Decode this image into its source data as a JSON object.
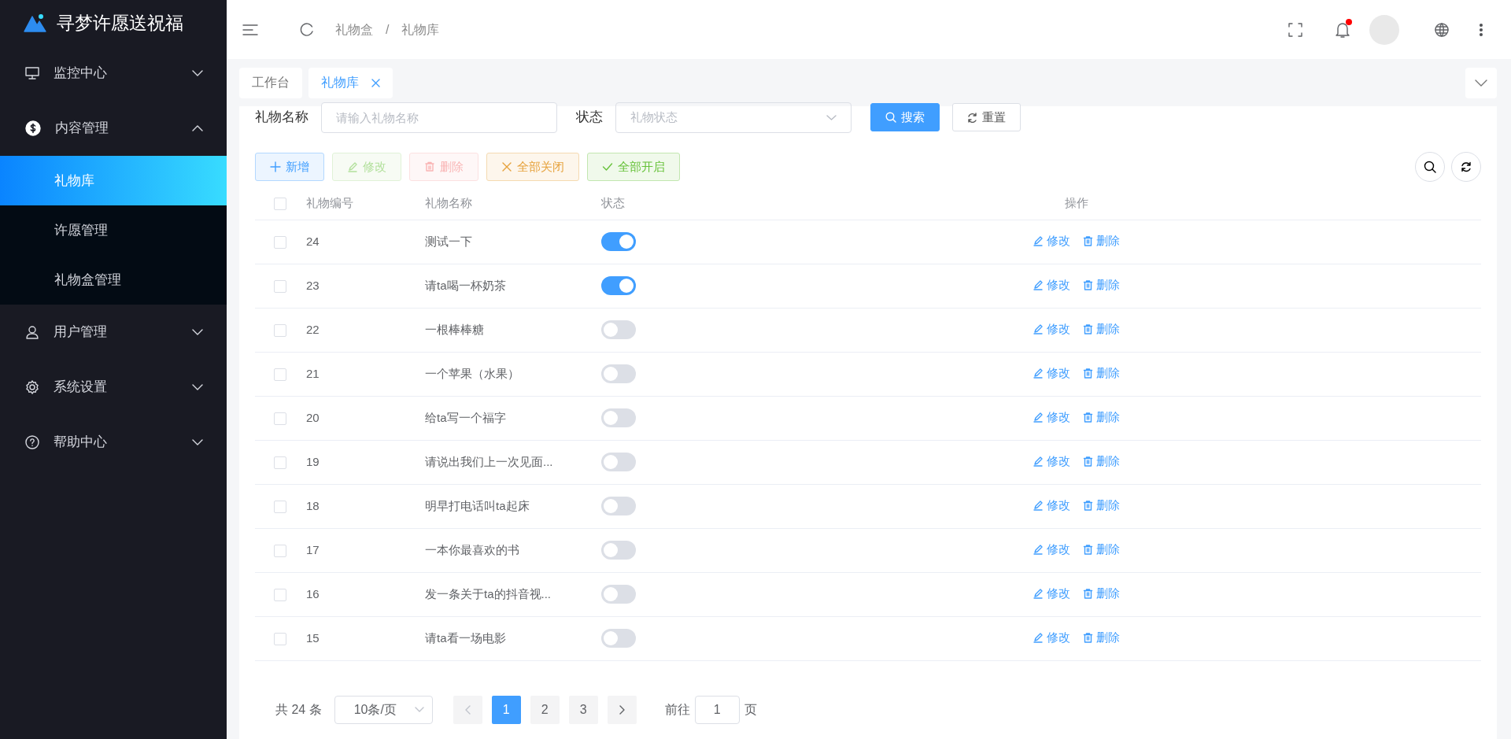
{
  "app": {
    "title": "寻梦许愿送祝福"
  },
  "sidebar": {
    "items": [
      {
        "label": "监控中心",
        "expanded": false
      },
      {
        "label": "内容管理",
        "expanded": true,
        "children": [
          {
            "label": "礼物库",
            "selected": true
          },
          {
            "label": "许愿管理",
            "selected": false
          },
          {
            "label": "礼物盒管理",
            "selected": false
          }
        ]
      },
      {
        "label": "用户管理",
        "expanded": false
      },
      {
        "label": "系统设置",
        "expanded": false
      },
      {
        "label": "帮助中心",
        "expanded": false
      }
    ]
  },
  "header": {
    "breadcrumb": [
      "礼物盒",
      "礼物库"
    ],
    "separator": "/",
    "notification_dot": true
  },
  "tabs": [
    {
      "label": "工作台",
      "selected": false,
      "closable": false
    },
    {
      "label": "礼物库",
      "selected": true,
      "closable": true
    }
  ],
  "filters": [
    {
      "label": "礼物名称",
      "kind": "text",
      "placeholder": "请输入礼物名称"
    },
    {
      "label": "状态",
      "kind": "select",
      "placeholder": "礼物状态"
    }
  ],
  "filter_buttons": [
    {
      "label": "搜索",
      "kind": "primary"
    },
    {
      "label": "重置",
      "kind": "plain"
    }
  ],
  "toolbar": [
    {
      "label": "新增",
      "kind": "add",
      "disabled": false
    },
    {
      "label": "修改",
      "kind": "edit",
      "disabled": true
    },
    {
      "label": "删除",
      "kind": "delete",
      "disabled": true
    },
    {
      "label": "全部关闭",
      "kind": "close",
      "disabled": false
    },
    {
      "label": "全部开启",
      "kind": "open",
      "disabled": false
    }
  ],
  "table": {
    "columns": [
      "礼物编号",
      "礼物名称",
      "状态",
      "操作"
    ],
    "all_checked": false,
    "rows": [
      {
        "id": "24",
        "name": "测试一下",
        "on": true,
        "checked": false,
        "actions": [
          "修改",
          "删除"
        ]
      },
      {
        "id": "23",
        "name": "请ta喝一杯奶茶",
        "on": true,
        "checked": false,
        "actions": [
          "修改",
          "删除"
        ]
      },
      {
        "id": "22",
        "name": "一根棒棒糖",
        "on": false,
        "checked": false,
        "actions": [
          "修改",
          "删除"
        ]
      },
      {
        "id": "21",
        "name": "一个苹果（水果）",
        "on": false,
        "checked": false,
        "actions": [
          "修改",
          "删除"
        ]
      },
      {
        "id": "20",
        "name": "给ta写一个福字",
        "on": false,
        "checked": false,
        "actions": [
          "修改",
          "删除"
        ]
      },
      {
        "id": "19",
        "name": "请说出我们上一次见面...",
        "on": false,
        "checked": false,
        "actions": [
          "修改",
          "删除"
        ]
      },
      {
        "id": "18",
        "name": "明早打电话叫ta起床",
        "on": false,
        "checked": false,
        "actions": [
          "修改",
          "删除"
        ]
      },
      {
        "id": "17",
        "name": "一本你最喜欢的书",
        "on": false,
        "checked": false,
        "actions": [
          "修改",
          "删除"
        ]
      },
      {
        "id": "16",
        "name": "发一条关于ta的抖音视...",
        "on": false,
        "checked": false,
        "actions": [
          "修改",
          "删除"
        ]
      },
      {
        "id": "15",
        "name": "请ta看一场电影",
        "on": false,
        "checked": false,
        "actions": [
          "修改",
          "删除"
        ]
      }
    ]
  },
  "pagination": {
    "total": "共 24 条",
    "page_size": "10条/页",
    "pages": [
      {
        "label": "1",
        "selected": true
      },
      {
        "label": "2",
        "selected": false
      },
      {
        "label": "3",
        "selected": false
      }
    ],
    "goto_label": "前往",
    "goto_value": "1",
    "goto_suffix": "页"
  }
}
